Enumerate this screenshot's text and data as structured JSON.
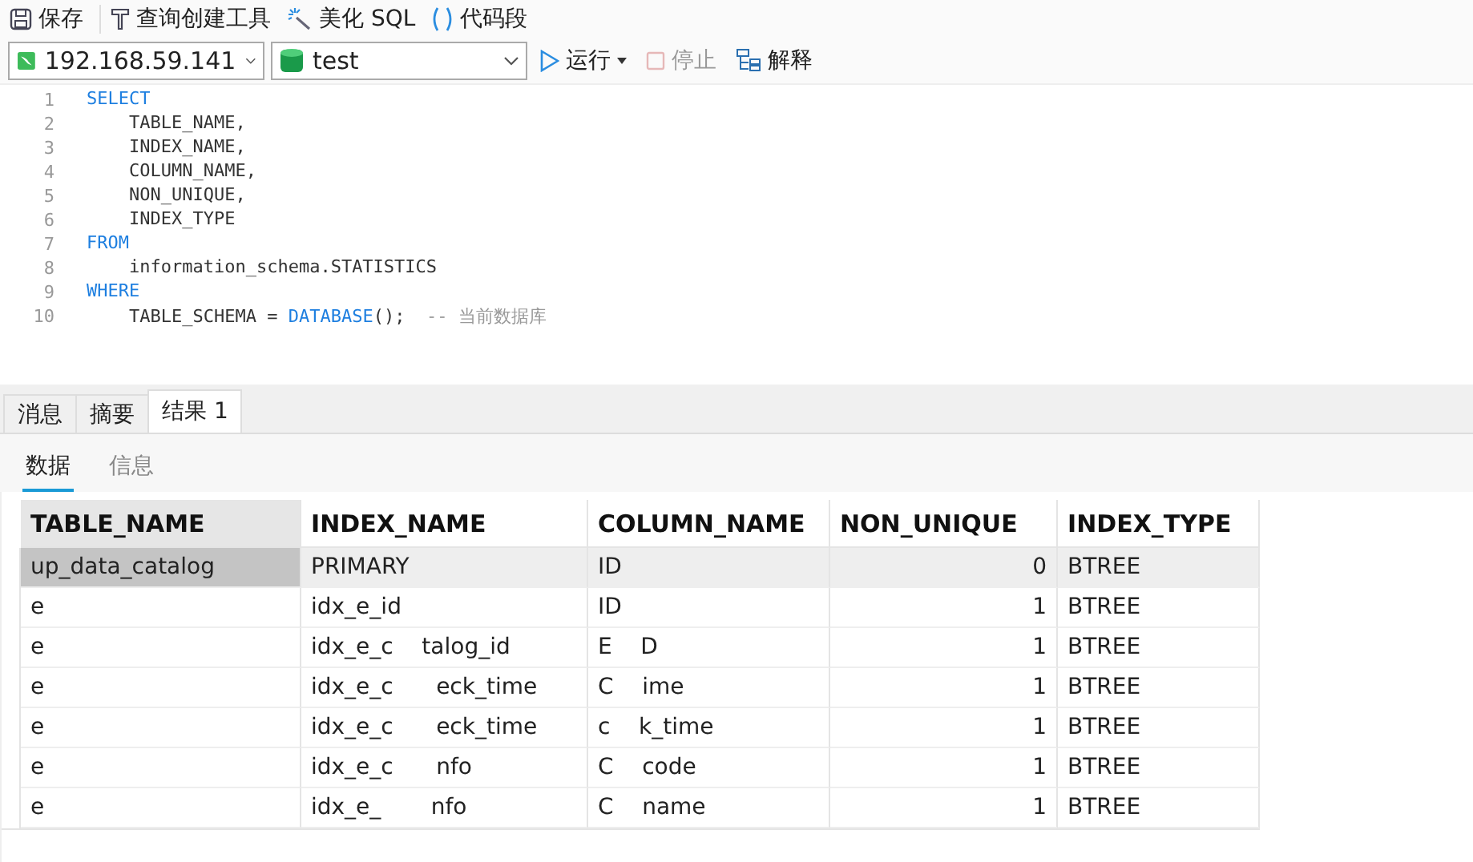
{
  "toolbar": [
    {
      "kind": "save",
      "label": "保存"
    },
    {
      "kind": "builder",
      "label": "查询创建工具"
    },
    {
      "kind": "beautify",
      "label": "美化 SQL"
    },
    {
      "kind": "snippet",
      "label": "代码段"
    }
  ],
  "connection": {
    "value": "192.168.59.141"
  },
  "database": {
    "value": "test"
  },
  "actions": [
    {
      "kind": "run",
      "label": "运行",
      "disabled": false
    },
    {
      "kind": "stop",
      "label": "停止",
      "disabled": true
    },
    {
      "kind": "explain",
      "label": "解释",
      "disabled": false
    }
  ],
  "editor": {
    "lines": [
      {
        "number": "1",
        "tokens": [
          {
            "kind": "keyword",
            "text": "SELECT"
          }
        ]
      },
      {
        "number": "2",
        "tokens": [
          {
            "kind": "plain",
            "text": "    TABLE_NAME,"
          }
        ]
      },
      {
        "number": "3",
        "tokens": [
          {
            "kind": "plain",
            "text": "    INDEX_NAME,"
          }
        ]
      },
      {
        "number": "4",
        "tokens": [
          {
            "kind": "plain",
            "text": "    COLUMN_NAME,"
          }
        ]
      },
      {
        "number": "5",
        "tokens": [
          {
            "kind": "plain",
            "text": "    NON_UNIQUE,"
          }
        ]
      },
      {
        "number": "6",
        "tokens": [
          {
            "kind": "plain",
            "text": "    INDEX_TYPE"
          }
        ]
      },
      {
        "number": "7",
        "tokens": [
          {
            "kind": "keyword",
            "text": "FROM"
          }
        ]
      },
      {
        "number": "8",
        "tokens": [
          {
            "kind": "plain",
            "text": "    information_schema.STATISTICS"
          }
        ]
      },
      {
        "number": "9",
        "tokens": [
          {
            "kind": "keyword",
            "text": "WHERE"
          }
        ]
      },
      {
        "number": "10",
        "tokens": [
          {
            "kind": "plain",
            "text": "    TABLE_SCHEMA = "
          },
          {
            "kind": "keyword",
            "text": "DATABASE"
          },
          {
            "kind": "plain",
            "text": "();  "
          },
          {
            "kind": "comment",
            "text": "-- 当前数据库"
          }
        ]
      }
    ]
  },
  "result_tabs": [
    {
      "label": "消息",
      "selected": false
    },
    {
      "label": "摘要",
      "selected": false
    },
    {
      "label": "结果 1",
      "selected": true
    }
  ],
  "view_tabs": [
    {
      "label": "数据",
      "selected": true
    },
    {
      "label": "信息",
      "selected": false
    }
  ],
  "table": {
    "columns": [
      {
        "label": "TABLE_NAME",
        "kind": "text"
      },
      {
        "label": "INDEX_NAME",
        "kind": "text"
      },
      {
        "label": "COLUMN_NAME",
        "kind": "text"
      },
      {
        "label": "NON_UNIQUE",
        "kind": "number"
      },
      {
        "label": "INDEX_TYPE",
        "kind": "text"
      }
    ],
    "rows": [
      {
        "selected": true,
        "cells": [
          "up_data_catalog",
          "PRIMARY",
          "ID",
          "0",
          "BTREE"
        ]
      },
      {
        "selected": false,
        "cells": [
          "e",
          "idx_e_id",
          "ID",
          "1",
          "BTREE"
        ]
      },
      {
        "selected": false,
        "cells": [
          "e",
          "idx_e_c    talog_id",
          "E    D",
          "1",
          "BTREE"
        ]
      },
      {
        "selected": false,
        "cells": [
          "e",
          "idx_e_c      eck_time",
          "C    ime",
          "1",
          "BTREE"
        ]
      },
      {
        "selected": false,
        "cells": [
          "e",
          "idx_e_c      eck_time",
          "c    k_time",
          "1",
          "BTREE"
        ]
      },
      {
        "selected": false,
        "cells": [
          "e",
          "idx_e_c      nfo",
          "C    code",
          "1",
          "BTREE"
        ]
      },
      {
        "selected": false,
        "cells": [
          "e",
          "idx_e_       nfo",
          "C    name",
          "1",
          "BTREE"
        ]
      }
    ]
  }
}
